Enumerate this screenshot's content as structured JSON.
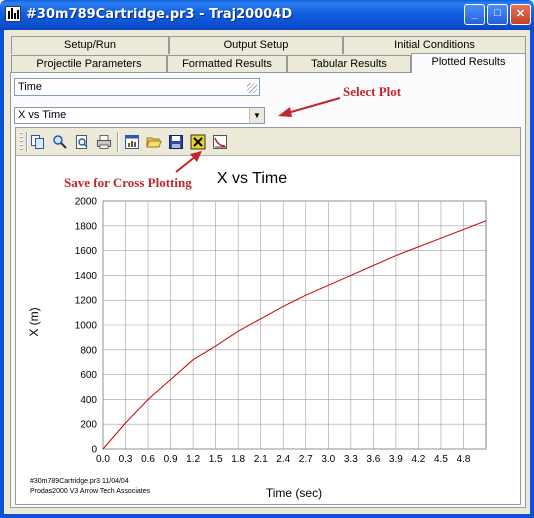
{
  "window": {
    "title": "#30m789Cartridge.pr3 - Traj20004D",
    "buttons": {
      "minimize": "_",
      "maximize": "□",
      "close": "✕"
    }
  },
  "tabs": {
    "row_top": [
      {
        "label": "Setup/Run"
      },
      {
        "label": "Output Setup"
      },
      {
        "label": "Initial Conditions"
      }
    ],
    "row_bottom": [
      {
        "label": "Projectile Parameters"
      },
      {
        "label": "Formatted Results"
      },
      {
        "label": "Tabular Results"
      },
      {
        "label": "Plotted Results",
        "active": true
      }
    ]
  },
  "form": {
    "field_value": "Time",
    "plot_select": {
      "selected": "X vs Time"
    }
  },
  "annotations": {
    "select_plot": "Select Plot",
    "cross_plot": "Save for Cross Plotting"
  },
  "toolbar": {
    "icons": [
      "copy-icon",
      "zoom-icon",
      "print-preview-icon",
      "print-icon",
      "chart-properties-icon",
      "open-icon",
      "save-icon",
      "save-cross-plot-icon",
      "cross-plot-icon"
    ]
  },
  "footer": {
    "line1": "#30m789Cartridge.pr3   11/04/04",
    "line2": "Prodas2000 V3 Arrow Tech Associates"
  },
  "colors": {
    "series": "#cc0000",
    "annotation": "#c0262a",
    "titlebar": "#0a5fdc",
    "grid": "#a0a0a0"
  },
  "chart_data": {
    "type": "line",
    "title": "X vs Time",
    "xlabel": "Time (sec)",
    "ylabel": "X (m)",
    "xlim": [
      0,
      5.1
    ],
    "ylim": [
      0,
      2000
    ],
    "x_ticks": [
      "0.0",
      "0.3",
      "0.6",
      "0.9",
      "1.2",
      "1.5",
      "1.8",
      "2.1",
      "2.4",
      "2.7",
      "3.0",
      "3.3",
      "3.6",
      "3.9",
      "4.2",
      "4.5",
      "4.8"
    ],
    "y_ticks": [
      "0",
      "200",
      "400",
      "600",
      "800",
      "1000",
      "1200",
      "1400",
      "1600",
      "1800",
      "2000"
    ],
    "grid": true,
    "series": [
      {
        "x": [
          0,
          0.3,
          0.6,
          0.9,
          1.2,
          1.5,
          1.8,
          2.1,
          2.4,
          2.7,
          3.0,
          3.3,
          3.6,
          3.9,
          4.2,
          4.5,
          4.8,
          5.1
        ],
        "values": [
          0,
          210,
          400,
          560,
          720,
          830,
          950,
          1050,
          1150,
          1240,
          1320,
          1400,
          1480,
          1560,
          1630,
          1700,
          1770,
          1840
        ]
      }
    ]
  }
}
